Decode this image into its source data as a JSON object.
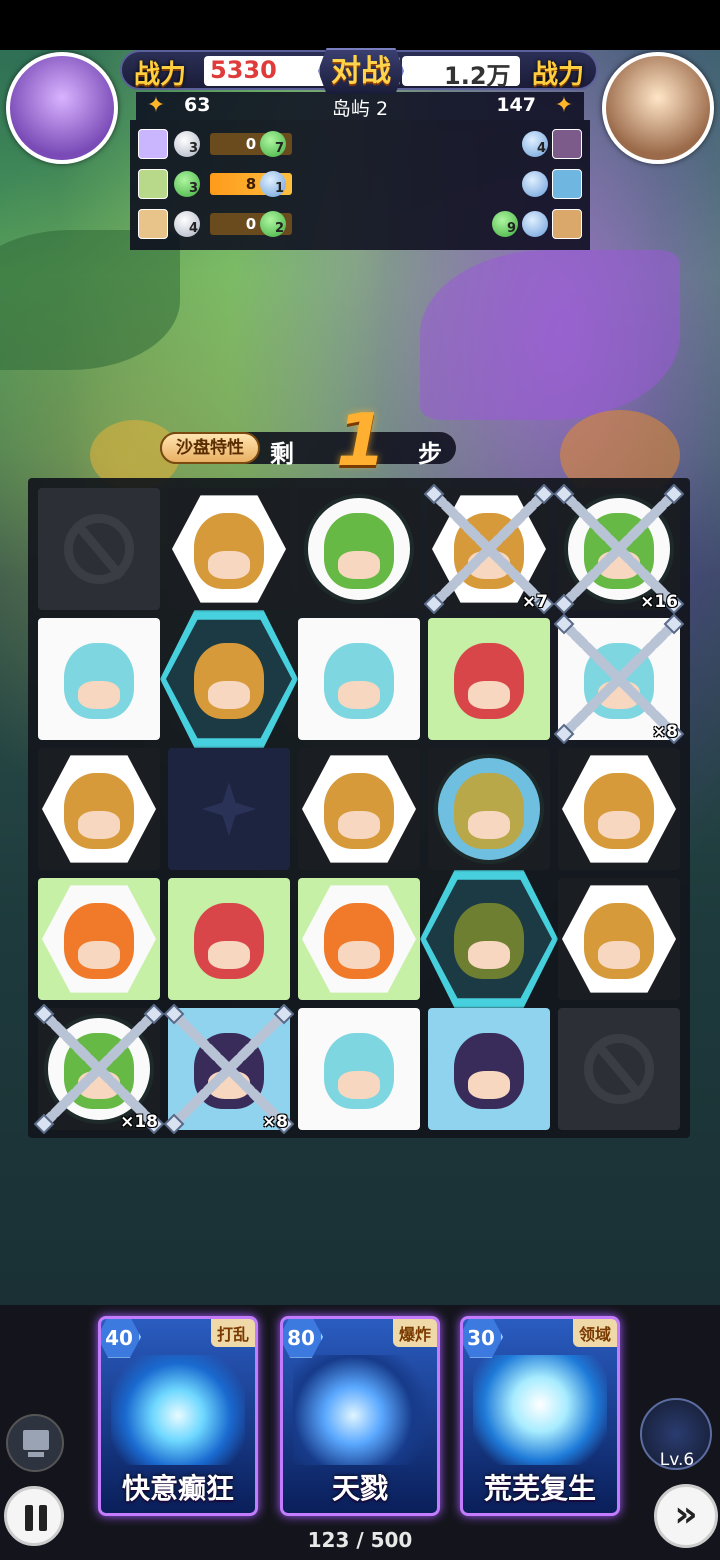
{
  "header": {
    "power_label_left": "战力",
    "power_value_left": "5330",
    "vs_label": "对战",
    "power_value_right": "1.2万",
    "power_label_right": "战力",
    "score_left": "63",
    "stage_name": "岛屿 2",
    "score_right": "147"
  },
  "rounds": [
    {
      "left_a": "3",
      "mid": "0",
      "left_b": "7",
      "right_a": "4"
    },
    {
      "left_a": "3",
      "mid": "8",
      "left_b": "1",
      "right_a": ""
    },
    {
      "left_a": "4",
      "mid": "0",
      "left_b": "2",
      "right_a": "9"
    }
  ],
  "steps": {
    "sandbox_label": "沙盘特性",
    "prefix": "剩",
    "count": "1",
    "suffix": "步"
  },
  "board": [
    [
      {
        "type": "block"
      },
      {
        "type": "elf",
        "shape": "hex",
        "bg": "white"
      },
      {
        "type": "green",
        "shape": "circle"
      },
      {
        "type": "elf",
        "shape": "hex",
        "chain": "×7"
      },
      {
        "type": "green",
        "shape": "circle",
        "chain": "×16"
      }
    ],
    [
      {
        "type": "bunny",
        "shape": "square",
        "bg": "white"
      },
      {
        "type": "elf",
        "shape": "hex",
        "glow": true
      },
      {
        "type": "bunny",
        "shape": "square",
        "bg": "white"
      },
      {
        "type": "red",
        "shape": "square",
        "bg": "green"
      },
      {
        "type": "bunny",
        "shape": "square",
        "bg": "white",
        "chain": "×8"
      }
    ],
    [
      {
        "type": "elf",
        "shape": "hex",
        "bg": "white"
      },
      {
        "type": "hole"
      },
      {
        "type": "elf",
        "shape": "hex",
        "bg": "white"
      },
      {
        "type": "skull",
        "shape": "circle-blue"
      },
      {
        "type": "elf",
        "shape": "hex",
        "bg": "white"
      }
    ],
    [
      {
        "type": "orange",
        "shape": "hex-green"
      },
      {
        "type": "red",
        "shape": "square",
        "bg": "green"
      },
      {
        "type": "orange",
        "shape": "hex-green"
      },
      {
        "type": "hood",
        "shape": "hex",
        "glow": true
      },
      {
        "type": "elf",
        "shape": "hex",
        "bg": "white"
      }
    ],
    [
      {
        "type": "green",
        "shape": "circle",
        "chain": "×18"
      },
      {
        "type": "purple",
        "shape": "square",
        "bg": "blue",
        "chain": "×8"
      },
      {
        "type": "bunny",
        "shape": "square",
        "bg": "white"
      },
      {
        "type": "purple",
        "shape": "square",
        "bg": "blue"
      },
      {
        "type": "block"
      }
    ]
  ],
  "skills": [
    {
      "cost": "40",
      "tag": "打乱",
      "name": "快意癫狂"
    },
    {
      "cost": "80",
      "tag": "爆炸",
      "name": "天戮"
    },
    {
      "cost": "30",
      "tag": "领域",
      "name": "荒芜复生"
    }
  ],
  "level_label": "Lv.6",
  "energy_text": "123 / 500",
  "colors": {
    "accent_gold": "#ffcf3f",
    "enemy_power": "#e03b3b",
    "glow_cyan": "#50f0ff",
    "skill_border": "#c47cff"
  },
  "icons": {
    "pause": "pause-icon",
    "pc": "computer-icon",
    "next": "fast-forward-icon",
    "star": "star-icon"
  }
}
